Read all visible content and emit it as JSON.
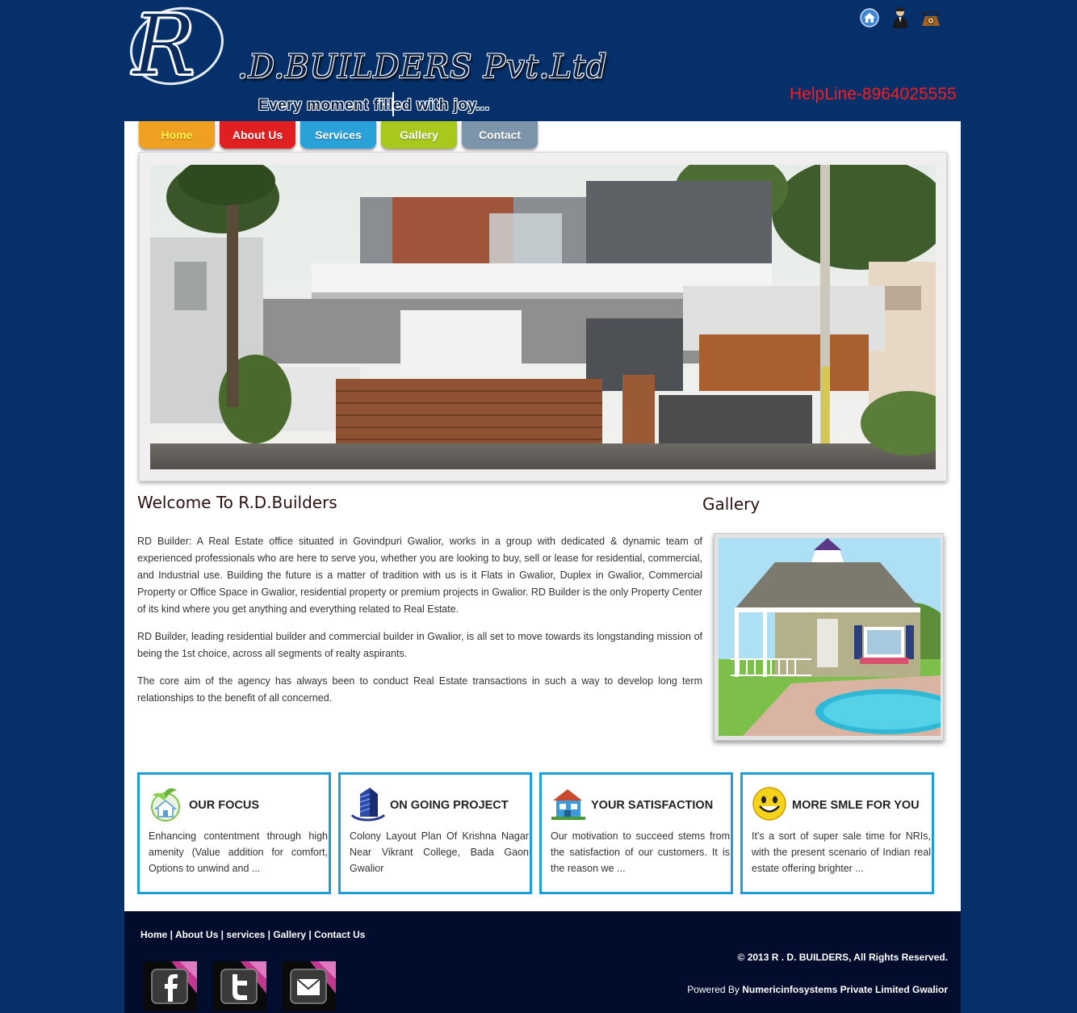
{
  "header": {
    "logo_letter": "R",
    "brand_name": ".D.BUILDERS Pvt.Ltd",
    "tagline": "Every moment filled with joy...",
    "helpline": "HelpLine-8964025555",
    "icons": [
      "home-icon",
      "user-icon",
      "phone-icon"
    ]
  },
  "nav": {
    "tabs": [
      {
        "label": "Home",
        "color": "#f0a020",
        "text_color": "#fff34d"
      },
      {
        "label": "About Us",
        "color": "#e02020",
        "text_color": "#ffffff"
      },
      {
        "label": "Services",
        "color": "#2aa1d8",
        "text_color": "#ffffff"
      },
      {
        "label": "Gallery",
        "color": "#a8c81e",
        "text_color": "#ffffff"
      },
      {
        "label": "Contact",
        "color": "#7d95aa",
        "text_color": "#ffffff"
      }
    ]
  },
  "welcome": {
    "title": "Welcome To R.D.Builders",
    "paragraphs": [
      "RD Builder: A Real Estate office situated in Govindpuri Gwalior, works in a group with dedicated & dynamic team of experienced professionals who are here to serve you, whether you are looking to buy, sell or lease for residential, commercial, and Industrial use. Building the future is a matter of tradition with us is it Flats in Gwalior, Duplex in Gwalior, Commercial Property or Office Space in Gwalior, residential property or premium projects in Gwalior. RD Builder is the only Property Center of its kind where you get anything and everything related to Real Estate.",
      "RD Builder, leading residential builder and commercial builder in Gwalior, is all set to move towards its longstanding mission of being the 1st choice, across all segments of realty aspirants.",
      "The core aim of the agency has always been to conduct Real Estate transactions in such a way to develop long term relationships to the benefit of all concerned."
    ]
  },
  "gallery": {
    "title": "Gallery"
  },
  "boxes": [
    {
      "title": "OUR FOCUS",
      "text": "Enhancing contentment through high amenity (Value addition for comfort, Options to unwind and ...",
      "icon": "eco-house-icon"
    },
    {
      "title": "ON GOING PROJECT",
      "text": "Colony Layout Plan Of Krishna Nagar Near Vikrant College, Bada Gaon Gwalior",
      "icon": "building-icon"
    },
    {
      "title": "YOUR SATISFACTION",
      "text": "Our motivation to succeed stems from the satisfaction of our customers. It is the reason we ...",
      "icon": "house-icon"
    },
    {
      "title": "MORE SMLE FOR YOU",
      "text": "It's a sort of super sale time for NRIs, with the present scenario of Indian real estate offering brighter ...",
      "icon": "smiley-icon"
    }
  ],
  "footer": {
    "links": [
      "Home",
      "About Us",
      "services",
      "Gallery",
      "Contact Us"
    ],
    "separator": " | ",
    "copyright": "© 2013 R . D. BUILDERS, All Rights Reserved.",
    "powered_prefix": "Powered By ",
    "powered_company": "Numericinfosystems Private Limited Gwalior",
    "socials": [
      "facebook-icon",
      "twitter-icon",
      "mail-icon"
    ]
  }
}
